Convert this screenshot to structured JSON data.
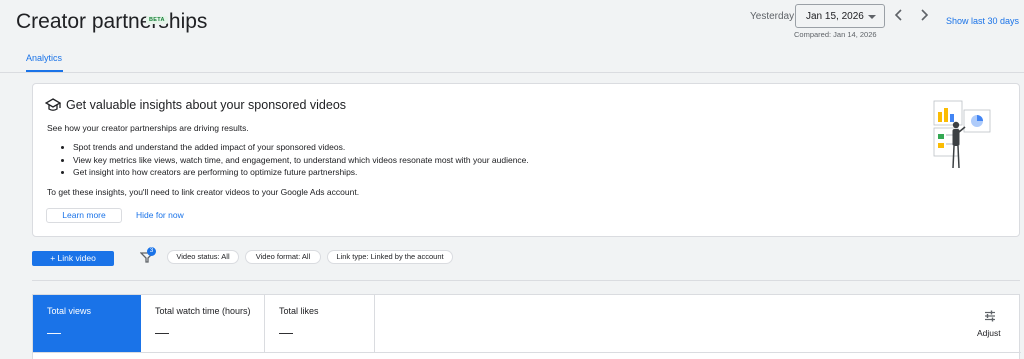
{
  "header": {
    "title": "Creator partnerships",
    "badge": "BETA",
    "date_label": "Yesterday",
    "date_value": "Jan 15, 2026",
    "compared": "Compared: Jan 14, 2026",
    "show_last": "Show last 30 days",
    "prev_icon": "chevron-left-icon",
    "next_icon": "chevron-right-icon"
  },
  "tabs": [
    {
      "label": "Analytics",
      "active": true
    }
  ],
  "promo": {
    "icon": "graduation-cap-icon",
    "title": "Get valuable insights about your sponsored videos",
    "intro": "See how your creator partnerships are driving results.",
    "bullets": [
      "Spot trends and understand the added impact of your sponsored videos.",
      "View key metrics like views, watch time, and engagement, to understand which videos resonate most with your audience.",
      "Get insight into how creators are performing to optimize future partnerships."
    ],
    "footer": "To get these insights, you'll need to link creator videos to your Google Ads account.",
    "learn_more": "Learn more",
    "hide": "Hide for now"
  },
  "toolbar": {
    "link_video": "Link video",
    "filter_icon": "filter-icon",
    "filter_count": "3",
    "chips": [
      "Video status: All",
      "Video format: All",
      "Link type: Linked by the account"
    ]
  },
  "metrics": [
    {
      "label": "Total views",
      "value": "—"
    },
    {
      "label": "Total watch time (hours)",
      "value": "—"
    },
    {
      "label": "Total likes",
      "value": "—"
    }
  ],
  "adjust": {
    "label": "Adjust",
    "icon": "tune-icon"
  },
  "colors": {
    "accent": "#1a73e8",
    "beta_green": "#188038",
    "background": "#f1f3f4"
  }
}
